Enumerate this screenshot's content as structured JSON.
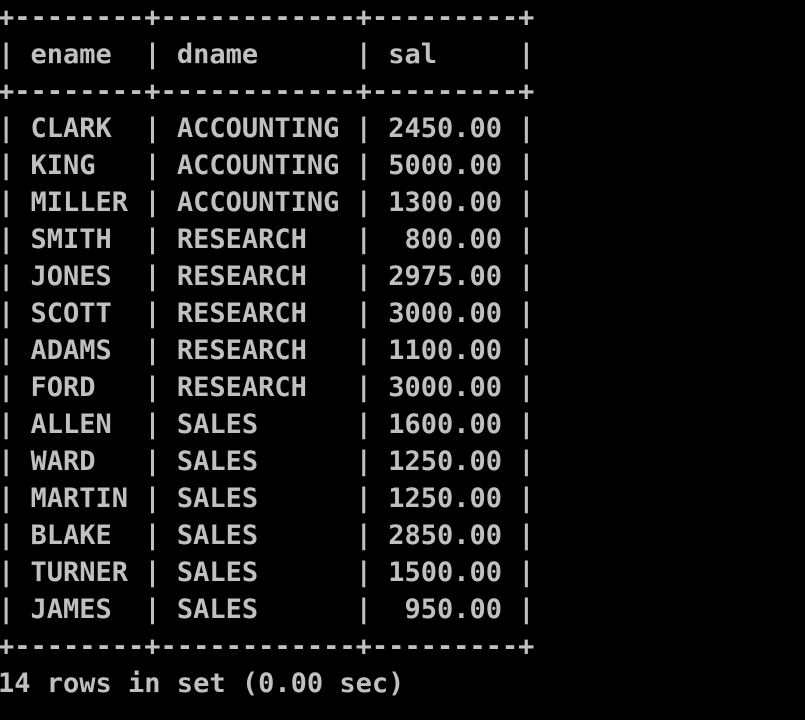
{
  "table": {
    "columns": [
      "ename",
      "dname",
      "sal"
    ],
    "rows": [
      [
        "CLARK",
        "ACCOUNTING",
        "2450.00"
      ],
      [
        "KING",
        "ACCOUNTING",
        "5000.00"
      ],
      [
        "MILLER",
        "ACCOUNTING",
        "1300.00"
      ],
      [
        "SMITH",
        "RESEARCH",
        "800.00"
      ],
      [
        "JONES",
        "RESEARCH",
        "2975.00"
      ],
      [
        "SCOTT",
        "RESEARCH",
        "3000.00"
      ],
      [
        "ADAMS",
        "RESEARCH",
        "1100.00"
      ],
      [
        "FORD",
        "RESEARCH",
        "3000.00"
      ],
      [
        "ALLEN",
        "SALES",
        "1600.00"
      ],
      [
        "WARD",
        "SALES",
        "1250.00"
      ],
      [
        "MARTIN",
        "SALES",
        "1250.00"
      ],
      [
        "BLAKE",
        "SALES",
        "2850.00"
      ],
      [
        "TURNER",
        "SALES",
        "1500.00"
      ],
      [
        "JAMES",
        "SALES",
        "950.00"
      ]
    ]
  },
  "status": "14 rows in set (0.00 sec)",
  "colors": {
    "background": "#000000",
    "text": "#c0c0c0"
  }
}
